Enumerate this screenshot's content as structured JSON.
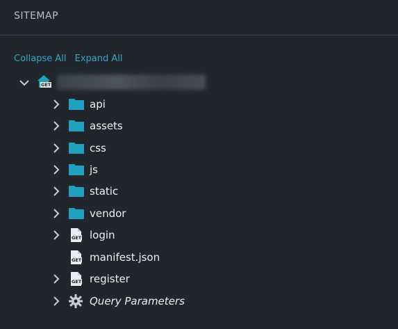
{
  "header": {
    "title": "SITEMAP"
  },
  "actions": {
    "collapse_all": "Collapse All",
    "expand_all": "Expand All"
  },
  "root": {
    "icon": "home-icon",
    "badge": "GET",
    "label": ""
  },
  "items": [
    {
      "label": "api",
      "icon": "folder-icon"
    },
    {
      "label": "assets",
      "icon": "folder-icon"
    },
    {
      "label": "css",
      "icon": "folder-icon"
    },
    {
      "label": "js",
      "icon": "folder-icon"
    },
    {
      "label": "static",
      "icon": "folder-icon"
    },
    {
      "label": "vendor",
      "icon": "folder-icon"
    },
    {
      "label": "login",
      "icon": "file-get-icon",
      "badge": "GET"
    },
    {
      "label": "manifest.json",
      "icon": "file-get-icon",
      "badge": "GET"
    },
    {
      "label": "register",
      "icon": "file-get-icon",
      "badge": "GET"
    },
    {
      "label": "Query Parameters",
      "icon": "gear-icon"
    }
  ],
  "colors": {
    "accent": "#2fa8c7",
    "folder": "#1fa1bf",
    "background": "#20262b"
  }
}
